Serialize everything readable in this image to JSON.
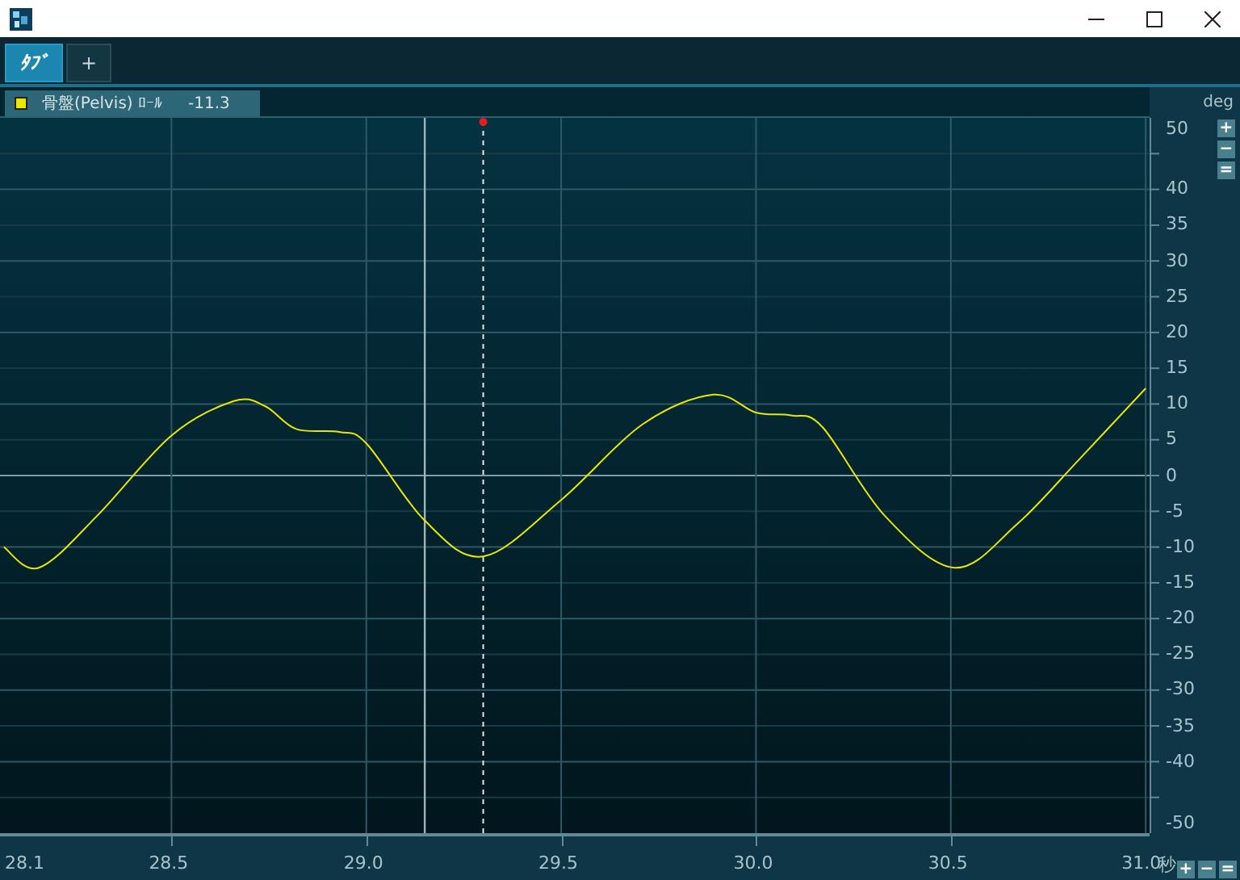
{
  "tabs": [
    {
      "label": "ﾀﾌﾞ",
      "selected": true
    }
  ],
  "add_tab_button": "+",
  "legend": {
    "value": "-11.3"
  },
  "y_buttons": [
    "+",
    "−",
    "="
  ],
  "x_buttons": [
    "+",
    "−",
    "="
  ],
  "chart_data": {
    "type": "line",
    "xlabel": "秒",
    "ylabel": "deg",
    "x": [
      28.07,
      28.16,
      28.31,
      28.5,
      28.66,
      28.74,
      28.82,
      28.93,
      29.0,
      29.15,
      29.3,
      29.5,
      29.71,
      29.89,
      30.0,
      30.09,
      30.17,
      30.33,
      30.51,
      30.67,
      30.83,
      31.0
    ],
    "series": [
      {
        "name": "骨盤(Pelvis) ﾛｰﾙ",
        "color": "#e8e800",
        "values": [
          -10,
          -12.9,
          -5.6,
          5.6,
          10.4,
          9.7,
          6.5,
          6.1,
          4.5,
          -6.3,
          -11.3,
          -3.4,
          7.2,
          11.3,
          8.8,
          8.4,
          6.8,
          -5.6,
          -12.9,
          -6.8,
          2.3,
          12.2
        ]
      }
    ],
    "xlim": [
      28.06,
      31.01
    ],
    "ylim": [
      -50,
      50
    ],
    "xticks": [
      {
        "value": 28.1,
        "label": "28.1"
      },
      {
        "value": 28.5,
        "label": "28.5"
      },
      {
        "value": 29,
        "label": "29.0"
      },
      {
        "value": 29.5,
        "label": "29.5"
      },
      {
        "value": 30,
        "label": "30.0"
      },
      {
        "value": 30.5,
        "label": "30.5"
      },
      {
        "value": 31,
        "label": "31.0"
      }
    ],
    "yticks": [
      50,
      40,
      35,
      30,
      25,
      20,
      15,
      10,
      5,
      0,
      -5,
      -10,
      -15,
      -20,
      -25,
      -30,
      -35,
      -40,
      -50
    ],
    "grid": true,
    "ref_lines": [
      {
        "axis": "x",
        "value": 29.15
      },
      {
        "axis": "x",
        "value": 29.3
      }
    ]
  }
}
